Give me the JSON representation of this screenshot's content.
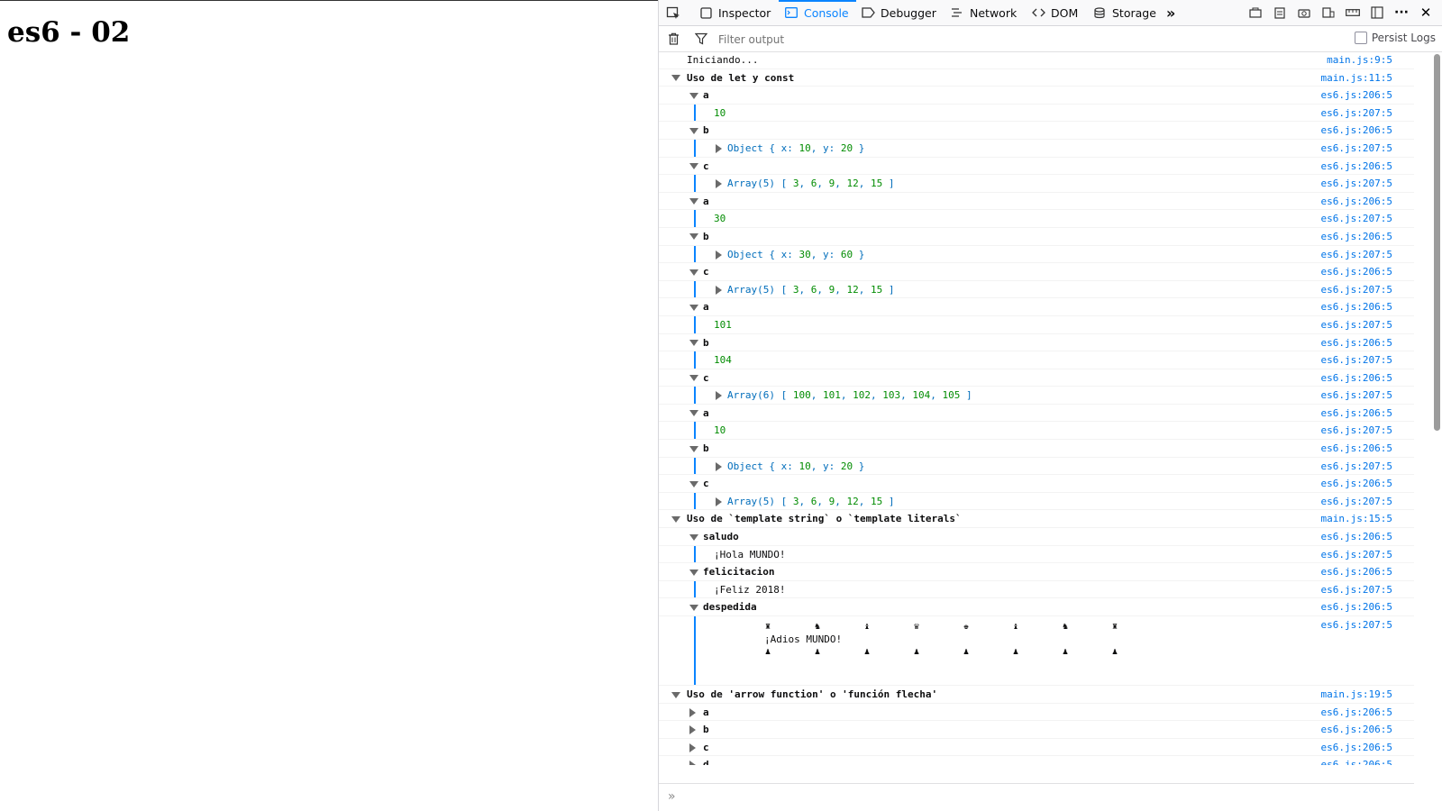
{
  "page": {
    "title": "es6 - 02"
  },
  "devtools": {
    "tabs": [
      {
        "label": "Inspector",
        "icon": "inspector-icon"
      },
      {
        "label": "Console",
        "icon": "console-icon"
      },
      {
        "label": "Debugger",
        "icon": "debugger-icon"
      },
      {
        "label": "Network",
        "icon": "network-icon"
      },
      {
        "label": "DOM",
        "icon": "dom-icon"
      },
      {
        "label": "Storage",
        "icon": "storage-icon"
      }
    ],
    "more_tabs": "»",
    "close": "✕",
    "accent": "#0a84ff"
  },
  "filter": {
    "placeholder": "Filter output",
    "persist_label": "Persist Logs"
  },
  "logs": {
    "iniciando": {
      "text": "Iniciando...",
      "loc": "main.js:9:5"
    },
    "g1": {
      "title": "Uso de let y const",
      "loc": "main.js:11:5"
    },
    "g2": {
      "title": "Uso de `template string` o `template literals`",
      "loc": "main.js:15:5"
    },
    "g3": {
      "title": "Uso de 'arrow function' o 'función flecha'",
      "loc": "main.js:19:5"
    },
    "loc206": "es6.js:206:5",
    "loc207": "es6.js:207:5",
    "saludo": {
      "label": "saludo",
      "value": "¡Hola MUNDO!"
    },
    "felicitacion": {
      "label": "felicitacion",
      "value": "¡Feliz 2018!"
    },
    "despedida": {
      "label": "despedida",
      "value": "¡Adios MUNDO!"
    }
  }
}
